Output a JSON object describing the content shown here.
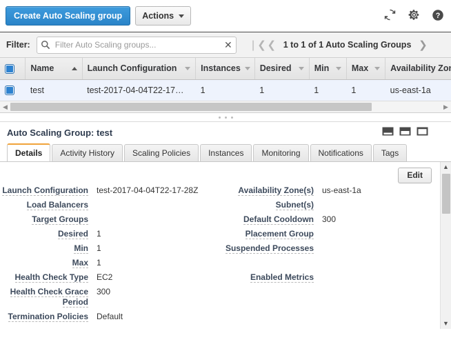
{
  "toolbar": {
    "create_label": "Create Auto Scaling group",
    "actions_label": "Actions",
    "icons": [
      "refresh-icon",
      "gear-icon",
      "help-icon"
    ]
  },
  "filter": {
    "label": "Filter:",
    "placeholder": "Filter Auto Scaling groups...",
    "value": "",
    "clear_glyph": "✕"
  },
  "pagination": {
    "first_glyph": "❘❮",
    "prev_glyph": "❮",
    "next_glyph": "❯",
    "text": "1 to 1 of 1 Auto Scaling Groups"
  },
  "table": {
    "columns": [
      {
        "label": "Name",
        "sort": "asc"
      },
      {
        "label": "Launch Configuration",
        "sort": "none"
      },
      {
        "label": "Instances",
        "sort": "none"
      },
      {
        "label": "Desired",
        "sort": "none"
      },
      {
        "label": "Min",
        "sort": "none"
      },
      {
        "label": "Max",
        "sort": "none"
      },
      {
        "label": "Availability Zones",
        "sort": "none"
      }
    ],
    "rows": [
      {
        "selected": true,
        "name": "test",
        "launch_configuration": "test-2017-04-04T22-17…",
        "instances": "1",
        "desired": "1",
        "min": "1",
        "max": "1",
        "availability_zones": "us-east-1a"
      }
    ]
  },
  "detail": {
    "title": "Auto Scaling Group: test",
    "panel_layout_icons": [
      "layout-bottom-icon",
      "layout-split-icon",
      "layout-top-icon"
    ],
    "edit_label": "Edit",
    "tabs": [
      {
        "label": "Details",
        "active": true
      },
      {
        "label": "Activity History",
        "active": false
      },
      {
        "label": "Scaling Policies",
        "active": false
      },
      {
        "label": "Instances",
        "active": false
      },
      {
        "label": "Monitoring",
        "active": false
      },
      {
        "label": "Notifications",
        "active": false
      },
      {
        "label": "Tags",
        "active": false
      }
    ],
    "left_fields": [
      {
        "label": "Launch Configuration",
        "value": "test-2017-04-04T22-17-28Z"
      },
      {
        "label": "Load Balancers",
        "value": ""
      },
      {
        "label": "Target Groups",
        "value": ""
      },
      {
        "label": "Desired",
        "value": "1"
      },
      {
        "label": "Min",
        "value": "1"
      },
      {
        "label": "Max",
        "value": "1"
      },
      {
        "label": "Health Check Type",
        "value": "EC2"
      },
      {
        "label": "Health Check Grace Period",
        "value": "300"
      },
      {
        "label": "Termination Policies",
        "value": "Default"
      }
    ],
    "right_fields": [
      {
        "label": "Availability Zone(s)",
        "value": "us-east-1a"
      },
      {
        "label": "Subnet(s)",
        "value": ""
      },
      {
        "label": "Default Cooldown",
        "value": "300"
      },
      {
        "label": "Placement Group",
        "value": ""
      },
      {
        "label": "Suspended Processes",
        "value": ""
      },
      {
        "label": "Enabled Metrics",
        "value": ""
      }
    ]
  },
  "colors": {
    "primary_blue": "#2a84c8",
    "active_tab_accent": "#f0a33a",
    "row_selected_bg": "#eef3fd",
    "label_text": "#3d4a5c"
  }
}
